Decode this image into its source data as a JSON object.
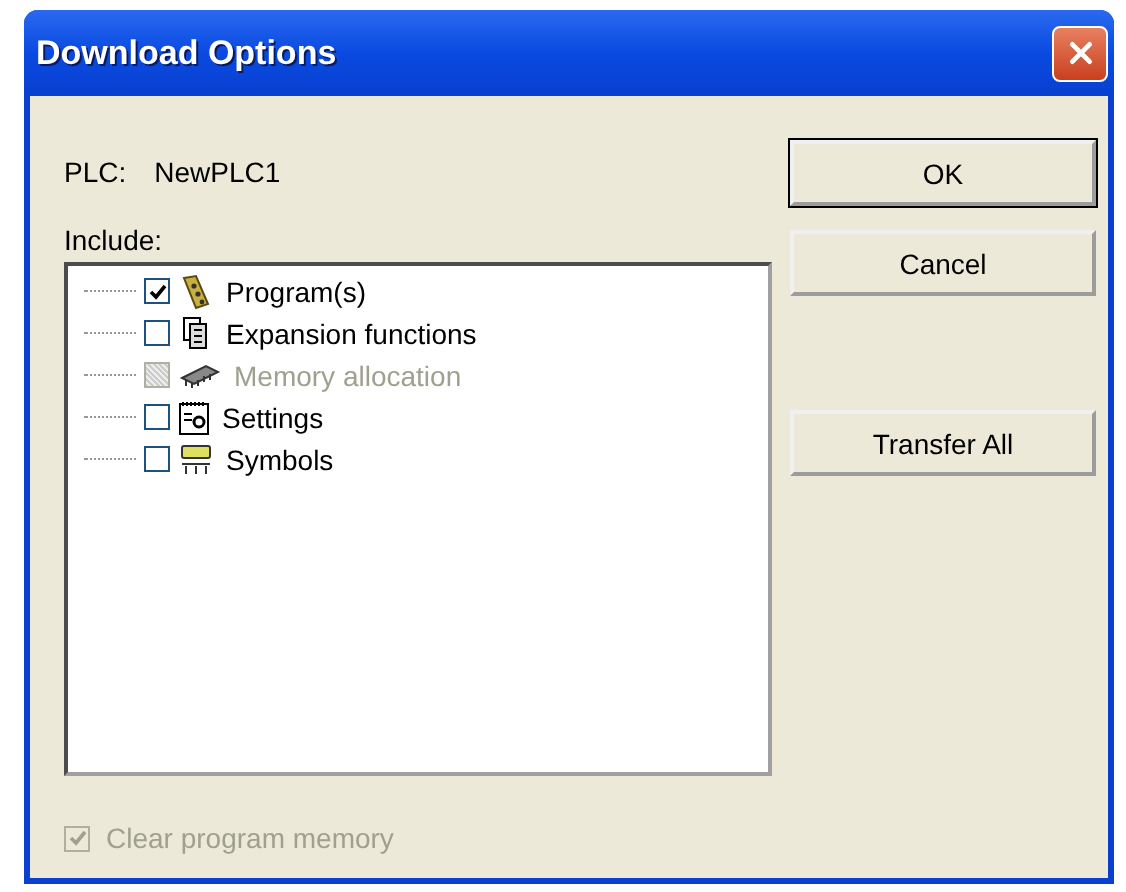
{
  "window": {
    "title": "Download Options"
  },
  "plc": {
    "label": "PLC:",
    "value": "NewPLC1"
  },
  "include": {
    "label": "Include:",
    "items": [
      {
        "label": "Program(s)",
        "kind": "program",
        "checked": true,
        "disabled": false
      },
      {
        "label": "Expansion functions",
        "kind": "expansion",
        "checked": false,
        "disabled": false
      },
      {
        "label": "Memory allocation",
        "kind": "memory",
        "checked": false,
        "disabled": true
      },
      {
        "label": "Settings",
        "kind": "settings",
        "checked": false,
        "disabled": false
      },
      {
        "label": "Symbols",
        "kind": "symbols",
        "checked": false,
        "disabled": false
      }
    ]
  },
  "buttons": [
    {
      "label": "OK",
      "default": true
    },
    {
      "label": "Cancel",
      "default": false
    },
    {
      "label": "Transfer All",
      "default": false
    }
  ],
  "clear_memory": {
    "label": "Clear program memory",
    "checked": true,
    "disabled": true
  }
}
